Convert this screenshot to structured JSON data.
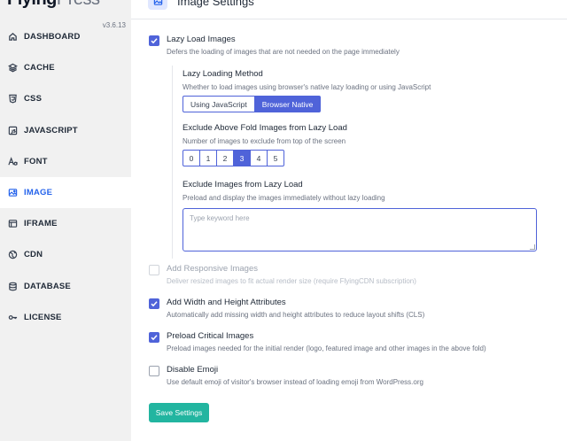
{
  "brand": {
    "name_bold": "Flying",
    "name_light": "Press",
    "version": "v3.6.13"
  },
  "sidebar": {
    "items": [
      {
        "label": "DASHBOARD",
        "icon": "home-icon",
        "active": false
      },
      {
        "label": "CACHE",
        "icon": "layers-icon",
        "active": false
      },
      {
        "label": "CSS",
        "icon": "css-icon",
        "active": false
      },
      {
        "label": "JAVASCRIPT",
        "icon": "js-icon",
        "active": false
      },
      {
        "label": "FONT",
        "icon": "font-icon",
        "active": false
      },
      {
        "label": "IMAGE",
        "icon": "image-icon",
        "active": true
      },
      {
        "label": "IFRAME",
        "icon": "iframe-icon",
        "active": false
      },
      {
        "label": "CDN",
        "icon": "globe-icon",
        "active": false
      },
      {
        "label": "DATABASE",
        "icon": "database-icon",
        "active": false
      },
      {
        "label": "LICENSE",
        "icon": "key-icon",
        "active": false
      }
    ]
  },
  "header": {
    "title": "Image Settings",
    "icon": "image-icon"
  },
  "options": {
    "lazy_load": {
      "title": "Lazy Load Images",
      "desc": "Defers the loading of images that are not needed on the page immediately",
      "checked": true
    },
    "responsive": {
      "title": "Add Responsive Images",
      "desc": "Deliver resized images to fit actual render size (require FlyingCDN subscription)",
      "checked": false,
      "disabled": true
    },
    "dimensions": {
      "title": "Add Width and Height Attributes",
      "desc": "Automatically add missing width and height attributes to reduce layout shifts (CLS)",
      "checked": true
    },
    "preload": {
      "title": "Preload Critical Images",
      "desc": "Preload images needed for the initial render (logo, featured image and other images in the above fold)",
      "checked": true
    },
    "emoji": {
      "title": "Disable Emoji",
      "desc": "Use default emoji of visitor's browser instead of loading emoji from WordPress.org",
      "checked": false
    }
  },
  "lazy_method": {
    "title": "Lazy Loading Method",
    "desc": "Whether to load images using browser's native lazy loading or using JavaScript",
    "options": [
      "Using JavaScript",
      "Browser Native"
    ],
    "selected": "Browser Native"
  },
  "exclude_fold": {
    "title": "Exclude Above Fold Images from Lazy Load",
    "desc": "Number of images to exclude from top of the screen",
    "options": [
      "0",
      "1",
      "2",
      "3",
      "4",
      "5"
    ],
    "selected": "3"
  },
  "exclude_images": {
    "title": "Exclude Images from Lazy Load",
    "desc": "Preload and display the images immediately without lazy loading",
    "placeholder": "Type keyword here",
    "value": ""
  },
  "save_label": "Save Settings",
  "colors": {
    "accent": "#4f63d9",
    "save": "#22b5a0",
    "sidebar_bg": "#f1f1f1"
  }
}
